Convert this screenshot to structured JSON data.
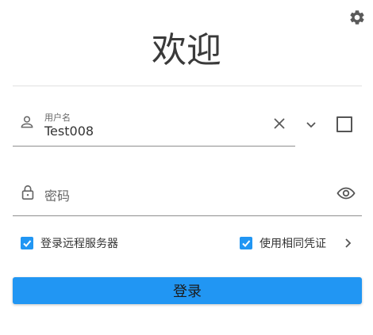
{
  "header": {
    "title": "欢迎"
  },
  "icons": {
    "settings": "gear-icon",
    "user": "person-icon",
    "clear": "close-icon",
    "dropdown": "chevron-down-icon",
    "lock": "lock-icon",
    "show_password": "eye-icon",
    "more": "chevron-right-icon"
  },
  "form": {
    "username": {
      "label": "用户名",
      "value": "Test008",
      "remember": false
    },
    "password": {
      "placeholder": "密码"
    },
    "remote_server": {
      "label": "登录远程服务器",
      "checked": true
    },
    "same_credentials": {
      "label": "使用相同凭证",
      "checked": true
    },
    "login_label": "登录"
  },
  "colors": {
    "accent": "#2196f3",
    "text": "#333333",
    "border": "#8f8f8f"
  }
}
